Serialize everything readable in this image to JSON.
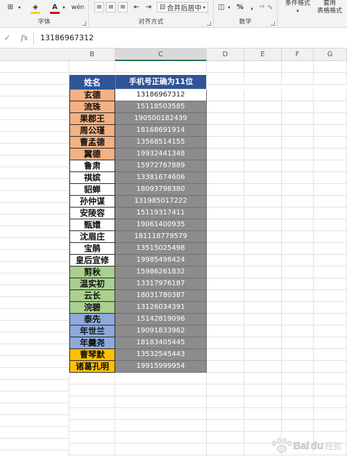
{
  "ribbon": {
    "groups": [
      {
        "label": "字体"
      },
      {
        "label": "对齐方式"
      },
      {
        "label": "数字"
      }
    ],
    "merge_label": "合并后居中",
    "percent_label": "%",
    "comma_label": ",",
    "cond_format_label": "条件格式",
    "table_format_label_1": "套用",
    "table_format_label_2": "表格格式",
    "colors": {
      "font_red": "#e00000",
      "fill_yellow": "#ffd400"
    }
  },
  "formula_bar": {
    "value": "13186967312"
  },
  "columns": [
    "B",
    "C",
    "D",
    "E",
    "F",
    "G"
  ],
  "table": {
    "header_name": "姓名",
    "header_phone": "手机号正确为11位",
    "rows": [
      {
        "name": "玄德",
        "phone": "13186967312",
        "color": "#f4b183"
      },
      {
        "name": "流珠",
        "phone": "15118503585",
        "color": "#f4b183"
      },
      {
        "name": "果郡王",
        "phone": "190500182439",
        "color": "#f4b183"
      },
      {
        "name": "周公瑾",
        "phone": "18168691914",
        "color": "#f4b183"
      },
      {
        "name": "曹孟德",
        "phone": "13568514155",
        "color": "#f4b183"
      },
      {
        "name": "翼德",
        "phone": "19932441348",
        "color": "#f4b183"
      },
      {
        "name": "鲁肃",
        "phone": "15972767889",
        "color": "#ffffff"
      },
      {
        "name": "祺嫔",
        "phone": "13381674606",
        "color": "#ffffff"
      },
      {
        "name": "貂蝉",
        "phone": "18093798380",
        "color": "#ffffff"
      },
      {
        "name": "孙仲谋",
        "phone": "131985017222",
        "color": "#ffffff"
      },
      {
        "name": "安陵容",
        "phone": "15119317411",
        "color": "#ffffff"
      },
      {
        "name": "甄嬛",
        "phone": "19061400935",
        "color": "#ffffff"
      },
      {
        "name": "沈眉庄",
        "phone": "181118779579",
        "color": "#ffffff"
      },
      {
        "name": "宝鹃",
        "phone": "13515025498",
        "color": "#ffffff"
      },
      {
        "name": "皇后宜修",
        "phone": "19985498424",
        "color": "#ffffff"
      },
      {
        "name": "剪秋",
        "phone": "15986261832",
        "color": "#a9d08e"
      },
      {
        "name": "温实初",
        "phone": "13317976187",
        "color": "#a9d08e"
      },
      {
        "name": "云长",
        "phone": "18031780387",
        "color": "#a9d08e"
      },
      {
        "name": "浣碧",
        "phone": "13126034391",
        "color": "#a9d08e"
      },
      {
        "name": "泰先",
        "phone": "15142819096",
        "color": "#8eaadb"
      },
      {
        "name": "年世兰",
        "phone": "19091833962",
        "color": "#8eaadb"
      },
      {
        "name": "年羹尧",
        "phone": "18183405445",
        "color": "#8eaadb"
      },
      {
        "name": "曹琴默",
        "phone": "13532545443",
        "color": "#ffc000"
      },
      {
        "name": "诸葛孔明",
        "phone": "19915999954",
        "color": "#ffc000"
      }
    ]
  },
  "watermark": {
    "brand": "Bai",
    "brand2": "du",
    "suffix": "经验"
  }
}
